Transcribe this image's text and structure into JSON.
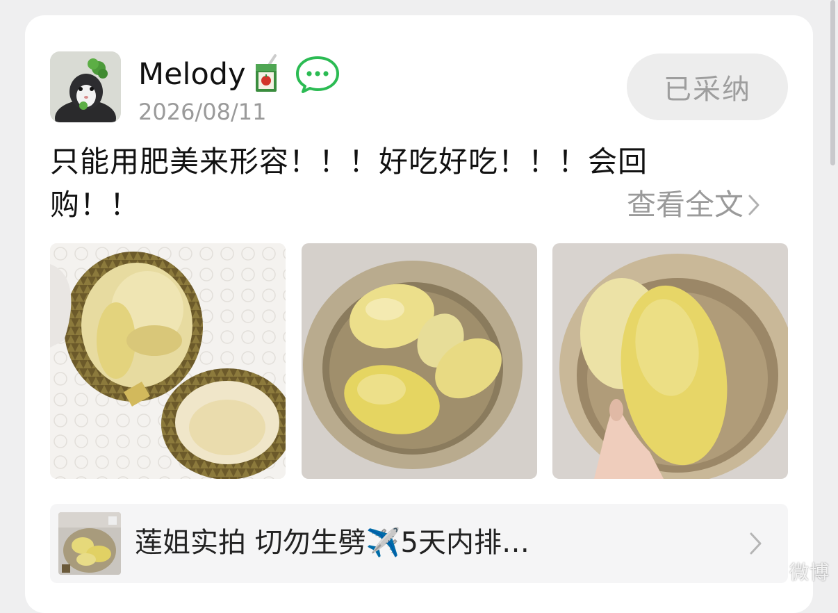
{
  "review": {
    "username": "Melody",
    "date": "2026/08/11",
    "adopt_label": "已采纳",
    "text": "只能用肥美来形容！！！好吃好吃！！！会回购！！",
    "see_all_label": "查看全文",
    "photos": [
      "durian-open-shell-photo",
      "durian-flesh-in-bowl-photo",
      "durian-flesh-in-hand-photo"
    ]
  },
  "product": {
    "title": "莲姐实拍 切勿生劈✈️5天内排…"
  },
  "watermark": "微博",
  "colors": {
    "background": "#efeff0",
    "card": "#ffffff",
    "chat_icon": "#2bbb53",
    "muted_text": "#9a9a9a",
    "button_bg": "#ededed"
  }
}
